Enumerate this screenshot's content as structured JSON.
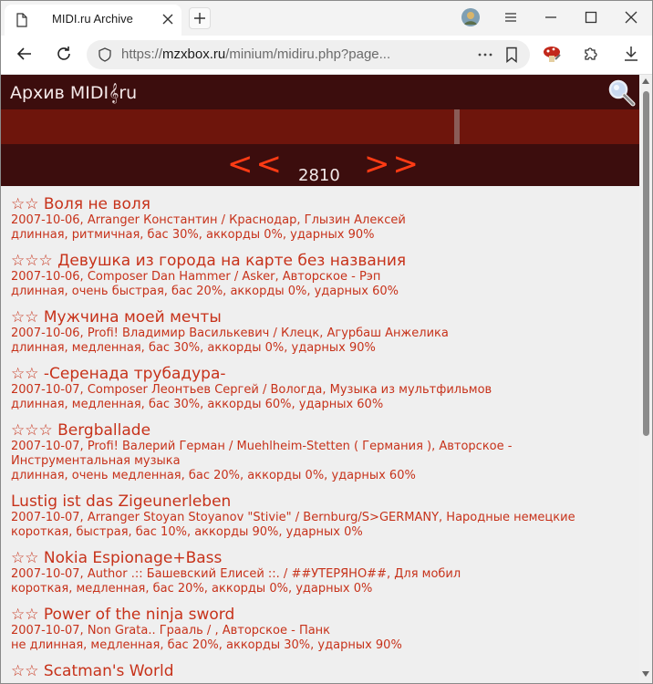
{
  "browser": {
    "tab_title": "MIDI.ru Archive",
    "url_host": "mzxbox.ru",
    "url_prefix": "https://",
    "url_path": "/minium/midiru.php?page..."
  },
  "site": {
    "title": "Архив MIDI",
    "title_clef": "𝄞",
    "title_suffix": "ru",
    "pager": {
      "prev_label": "<<",
      "next_label": ">>",
      "page": "2810"
    }
  },
  "entries": [
    {
      "title": "☆☆ Воля не воля",
      "meta": "2007-10-06, Arranger Константин / Краснодар, Глызин Алексей",
      "tags": "длинная, ритмичная, бас 30%, аккорды 0%, ударных 90%"
    },
    {
      "title": "☆☆☆ Девушка из города на карте без названия",
      "meta": "2007-10-06, Composer Dan Hammer / Asker, Авторское - Рэп",
      "tags": "длинная, очень быстрая, бас 20%, аккорды 0%, ударных 60%"
    },
    {
      "title": "☆☆ Мужчина моей мечты",
      "meta": "2007-10-06, Profi! Владимир Василькевич / Клецк, Агурбаш Анжелика",
      "tags": "длинная, медленная, бас 30%, аккорды 0%, ударных 90%"
    },
    {
      "title": "☆☆ -Серенада трубадура-",
      "meta": "2007-10-07, Composer Леонтьев Сергей / Вологда, Музыка из мультфильмов",
      "tags": "длинная, медленная, бас 30%, аккорды 60%, ударных 60%"
    },
    {
      "title": "☆☆☆ Bergballade",
      "meta": "2007-10-07, Profi! Валерий Герман / Muehlheim-Stetten ( Германия ), Авторское - Инструментальная музыка",
      "tags": "длинная, очень медленная, бас 20%, аккорды 0%, ударных 60%"
    },
    {
      "title": "Lustig ist das Zigeunerleben",
      "meta": "2007-10-07, Arranger Stoyan Stoyanov \"Stivie\" / Bernburg/S>GERMANY, Народные немецкие",
      "tags": "короткая, быстрая, бас 10%, аккорды 90%, ударных 0%"
    },
    {
      "title": "☆☆ Nokia Espionage+Bass",
      "meta": "2007-10-07, Author .:: Башевский Елисей ::. / ##УТЕРЯНО##, Для мобил",
      "tags": "короткая, медленная, бас 20%, аккорды 0%, ударных 0%"
    },
    {
      "title": "☆☆ Power of the ninja sword",
      "meta": "2007-10-07, Non Grata.. Грааль / , Авторское - Панк",
      "tags": "не длинная, медленная, бас 20%, аккорды 30%, ударных 90%"
    },
    {
      "title": "☆☆ Scatman's World",
      "meta": "",
      "tags": ""
    }
  ],
  "colors": {
    "header_bg": "#3c0d0d",
    "band_bg": "#6e150c",
    "link": "#c7321a",
    "pager_arrows": "#ff3b14"
  }
}
